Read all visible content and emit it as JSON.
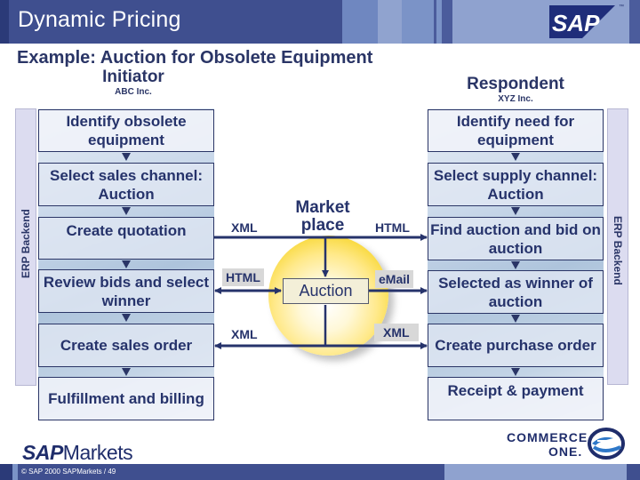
{
  "header": {
    "title": "Dynamic Pricing",
    "logo": "SAP",
    "trademark": "™"
  },
  "subtitle": "Example: Auction for Obsolete Equipment",
  "initiator": {
    "title": "Initiator",
    "company": "ABC Inc.",
    "erp_label": "ERP Backend",
    "steps": [
      "Identify obsolete equipment",
      "Select sales channel: Auction",
      "Create quotation",
      "Review bids and select winner",
      "Create sales order",
      "Fulfillment and billing"
    ]
  },
  "respondent": {
    "title": "Respondent",
    "company": "XYZ Inc.",
    "erp_label": "ERP Backend",
    "steps": [
      "Identify need for equipment",
      "Select supply channel: Auction",
      "Find auction and bid on auction",
      "Selected as winner of auction",
      "Create purchase order",
      "Receipt & payment"
    ]
  },
  "marketplace": {
    "label": "Market place",
    "center": "Auction",
    "protocols": {
      "left_top": "XML",
      "right_top": "HTML",
      "left_mid": "HTML",
      "right_mid": "eMail",
      "left_bottom": "XML",
      "right_bottom": "XML"
    }
  },
  "footer": {
    "brand_bold": "SAP",
    "brand_rest": "Markets",
    "copyright": "© SAP 2000 SAPMarkets / 49",
    "partner_line1": "COMMERCE",
    "partner_line2": "ONE."
  },
  "colors": {
    "header_bg": "#3f4f8f",
    "text_navy": "#26336b",
    "sphere_yellow": "#f6d21c"
  }
}
